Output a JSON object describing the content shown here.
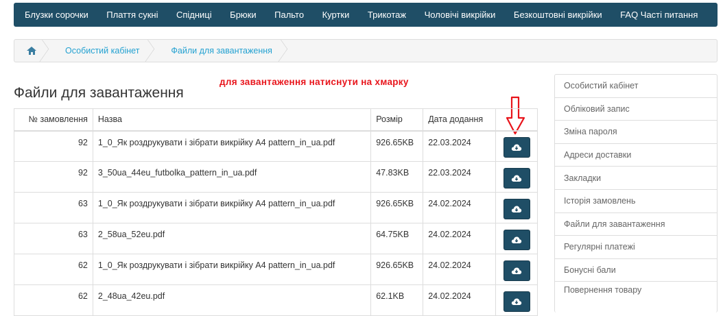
{
  "nav": {
    "items": [
      "Блузки сорочки",
      "Плаття сукні",
      "Спідниці",
      "Брюки",
      "Пальто",
      "Куртки",
      "Трикотаж",
      "Чоловічі викрійки",
      "Безкоштовні викрійки",
      "FAQ Часті питання"
    ]
  },
  "breadcrumb": {
    "home_icon": "home-icon",
    "items": [
      "Особистий кабінет",
      "Файли для завантаження"
    ]
  },
  "page": {
    "title": "Файли для завантаження",
    "annotation": "для завантаження натиснути на хмарку"
  },
  "table": {
    "headers": {
      "order": "№ замовлення",
      "name": "Назва",
      "size": "Розмір",
      "date": "Дата додання"
    },
    "rows": [
      {
        "order": "92",
        "name": "1_0_Як роздрукувати і зібрати викрійку А4 pattern_in_ua.pdf",
        "size": "926.65KB",
        "date": "22.03.2024"
      },
      {
        "order": "92",
        "name": "3_50ua_44eu_futbolka_pattern_in_ua.pdf",
        "size": "47.83KB",
        "date": "22.03.2024"
      },
      {
        "order": "63",
        "name": "1_0_Як роздрукувати і зібрати викрійку А4 pattern_in_ua.pdf",
        "size": "926.65KB",
        "date": "24.02.2024"
      },
      {
        "order": "63",
        "name": "2_58ua_52eu.pdf",
        "size": "64.75KB",
        "date": "24.02.2024"
      },
      {
        "order": "62",
        "name": "1_0_Як роздрукувати і зібрати викрійку А4 pattern_in_ua.pdf",
        "size": "926.65KB",
        "date": "24.02.2024"
      },
      {
        "order": "62",
        "name": "2_48ua_42eu.pdf",
        "size": "62.1KB",
        "date": "24.02.2024"
      }
    ],
    "action_icon": "cloud-download-icon"
  },
  "sidebar": {
    "items": [
      "Особистий кабінет",
      "Обліковий запис",
      "Зміна пароля",
      "Адреси доставки",
      "Закладки",
      "Історія замовлень",
      "Файли для завантаження",
      "Регулярні платежі",
      "Бонусні бали",
      "Повернення товару"
    ]
  },
  "colors": {
    "navbar": "#1f4e66",
    "link": "#23a1d1",
    "annotation": "#e8141b",
    "button": "#1f4e66"
  }
}
